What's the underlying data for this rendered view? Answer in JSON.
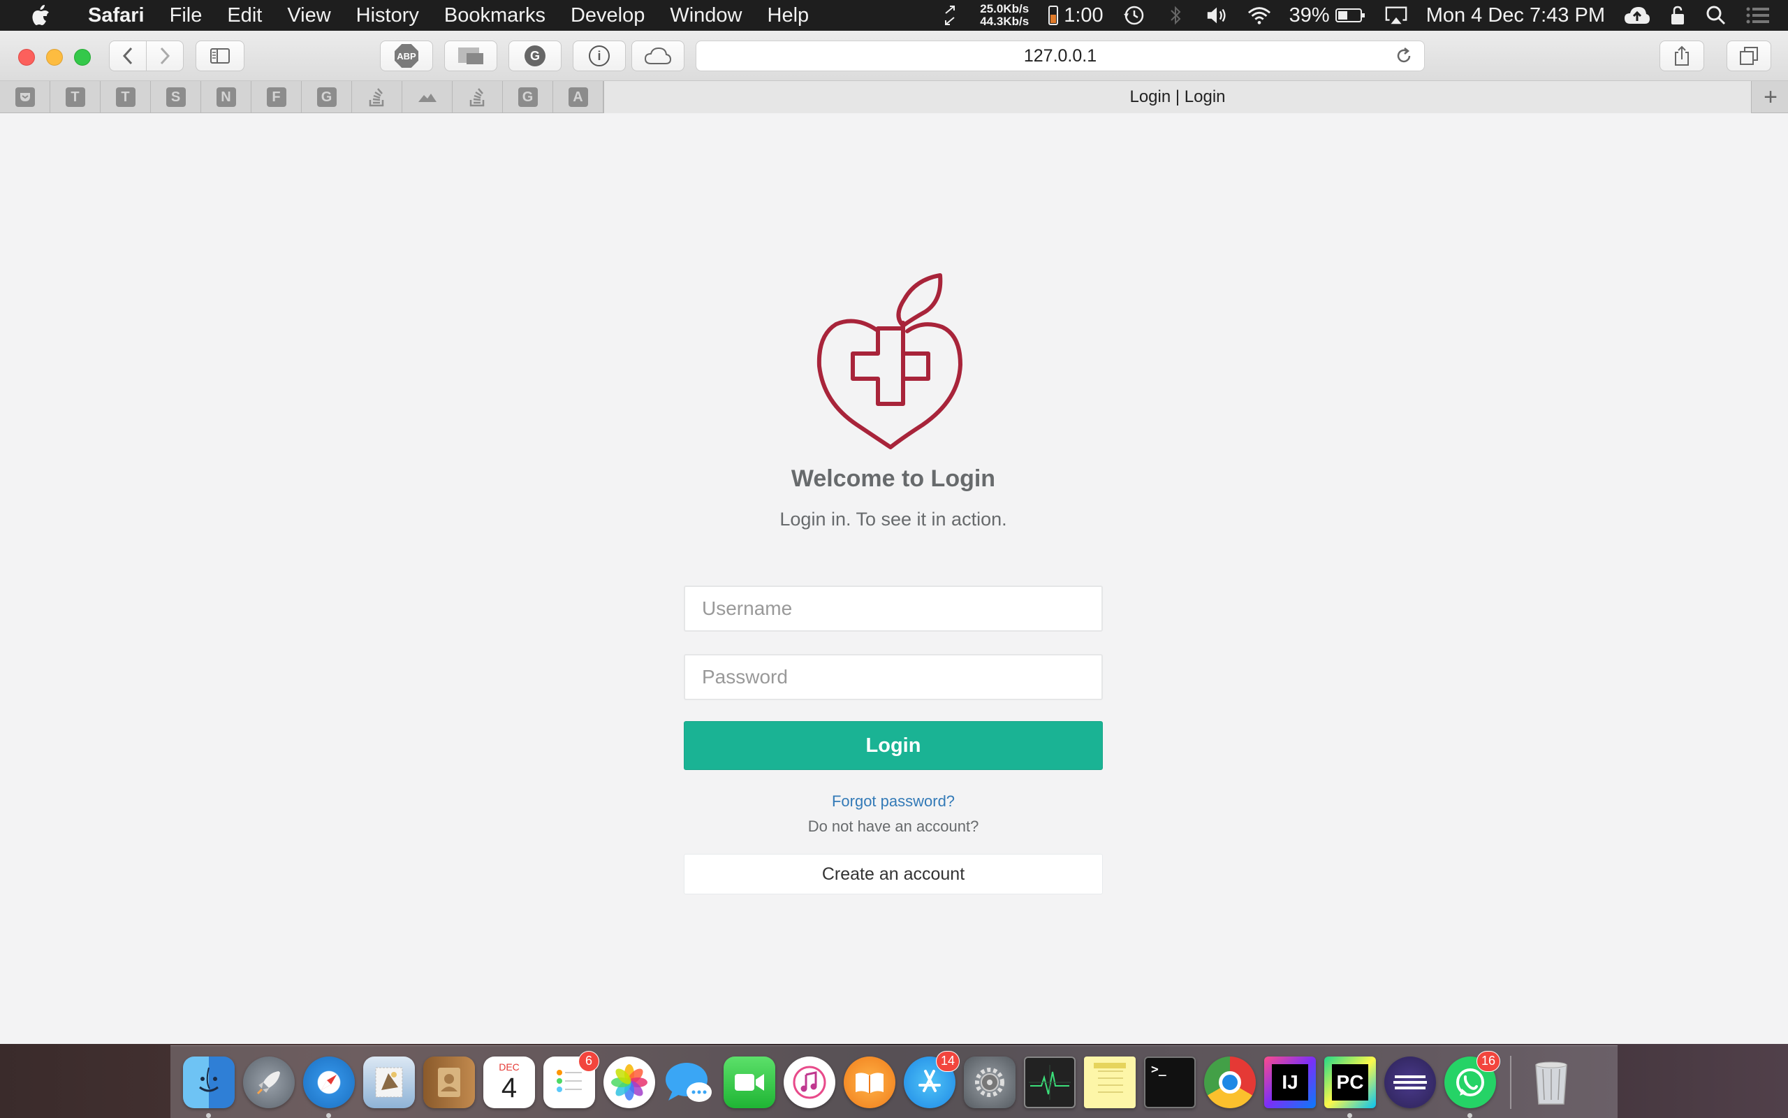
{
  "menubar": {
    "app_name": "Safari",
    "items": [
      "File",
      "Edit",
      "View",
      "History",
      "Bookmarks",
      "Develop",
      "Window",
      "Help"
    ],
    "net_up": "25.0Kb/s",
    "net_down": "44.3Kb/s",
    "timer": "1:00",
    "battery_percent": "39%",
    "datetime": "Mon 4 Dec  7:43 PM"
  },
  "toolbar": {
    "url": "127.0.0.1",
    "extension_labels": [
      "ABP",
      "",
      "G",
      "i",
      ""
    ]
  },
  "tabs": {
    "pinned": [
      "",
      "T",
      "T",
      "S",
      "N",
      "F",
      "G",
      "",
      "",
      "",
      "G",
      "A"
    ],
    "active_title": "Login | Login",
    "new_tab_label": "+"
  },
  "login": {
    "heading": "Welcome to Login",
    "subtitle": "Login in. To see it in action.",
    "username_placeholder": "Username",
    "password_placeholder": "Password",
    "login_button": "Login",
    "forgot_link": "Forgot password?",
    "no_account_text": "Do not have an account?",
    "create_account_button": "Create an account"
  },
  "colors": {
    "brand_red": "#a8243a",
    "login_button": "#1ab394",
    "link": "#337ab7",
    "text_gray": "#676a6c"
  },
  "dock": {
    "apps": [
      {
        "name": "Finder",
        "icon": "finder-icon",
        "badge": null,
        "running": true
      },
      {
        "name": "Launchpad",
        "icon": "rocket-icon",
        "badge": null,
        "running": false
      },
      {
        "name": "Safari",
        "icon": "compass-icon",
        "badge": null,
        "running": true
      },
      {
        "name": "Mail",
        "icon": "stamp-icon",
        "badge": null,
        "running": false
      },
      {
        "name": "Contacts",
        "icon": "contacts-book-icon",
        "badge": null,
        "running": false
      },
      {
        "name": "Calendar",
        "icon": "calendar-icon",
        "badge": null,
        "running": false,
        "month": "DEC",
        "day": "4"
      },
      {
        "name": "Reminders",
        "icon": "list-icon",
        "badge": "6",
        "running": false
      },
      {
        "name": "Photos",
        "icon": "flower-icon",
        "badge": null,
        "running": false
      },
      {
        "name": "Messages",
        "icon": "speech-bubble-icon",
        "badge": null,
        "running": false
      },
      {
        "name": "FaceTime",
        "icon": "video-camera-icon",
        "badge": null,
        "running": false
      },
      {
        "name": "iTunes",
        "icon": "music-note-icon",
        "badge": null,
        "running": false
      },
      {
        "name": "iBooks",
        "icon": "book-icon",
        "badge": null,
        "running": false
      },
      {
        "name": "App Store",
        "icon": "app-store-icon",
        "badge": "14",
        "running": false
      },
      {
        "name": "System Preferences",
        "icon": "gear-icon",
        "badge": null,
        "running": false
      },
      {
        "name": "Activity Monitor",
        "icon": "heartbeat-icon",
        "badge": null,
        "running": false
      },
      {
        "name": "Notes",
        "icon": "notepad-icon",
        "badge": null,
        "running": false
      },
      {
        "name": "Terminal",
        "icon": "terminal-icon",
        "badge": null,
        "running": false,
        "label": ">_"
      },
      {
        "name": "Chrome",
        "icon": "chrome-icon",
        "badge": null,
        "running": false
      },
      {
        "name": "IntelliJ IDEA",
        "icon": "intellij-icon",
        "badge": null,
        "running": false,
        "label": "IJ"
      },
      {
        "name": "PyCharm",
        "icon": "pycharm-icon",
        "badge": null,
        "running": true,
        "label": "PC"
      },
      {
        "name": "Eclipse",
        "icon": "eclipse-icon",
        "badge": null,
        "running": false
      },
      {
        "name": "WhatsApp",
        "icon": "whatsapp-icon",
        "badge": "16",
        "running": true
      }
    ],
    "trash": {
      "name": "Trash",
      "icon": "trash-icon"
    }
  }
}
